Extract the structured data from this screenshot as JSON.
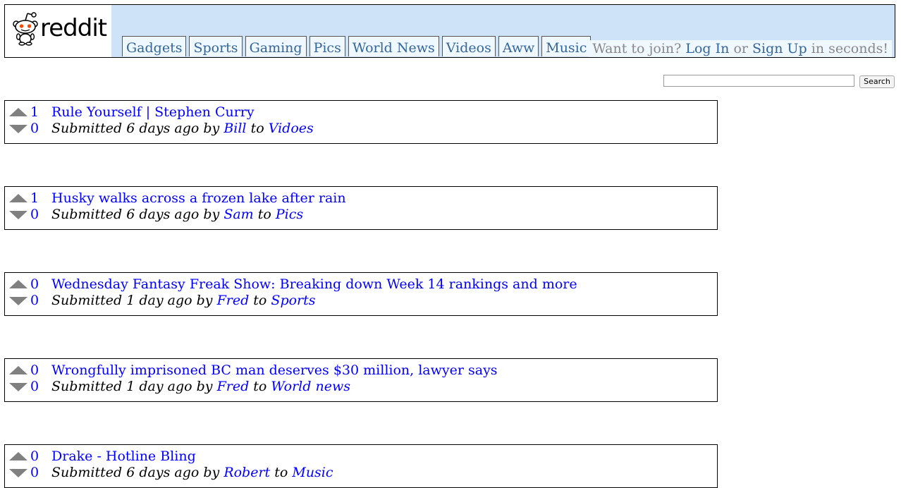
{
  "brand": {
    "name": "reddit"
  },
  "tabs": [
    "Gadgets",
    "Sports",
    "Gaming",
    "Pics",
    "World News",
    "Videos",
    "Aww",
    "Music"
  ],
  "join": {
    "prefix": "Want to join?",
    "login": "Log In",
    "or": "or",
    "signup": "Sign Up",
    "suffix": "in seconds!"
  },
  "search": {
    "placeholder": "",
    "button_label": "Search"
  },
  "meta_words": {
    "submitted": "Submitted",
    "by": "by",
    "to": "to"
  },
  "posts": [
    {
      "up": "1",
      "down": "0",
      "title": "Rule Yourself | Stephen Curry",
      "age": "6 days ago",
      "author": "Bill",
      "sub": "Vidoes"
    },
    {
      "up": "1",
      "down": "0",
      "title": "Husky walks across a frozen lake after rain",
      "age": "6 days ago",
      "author": "Sam",
      "sub": "Pics"
    },
    {
      "up": "0",
      "down": "0",
      "title": "Wednesday Fantasy Freak Show: Breaking down Week 14 rankings and more",
      "age": "1 day ago",
      "author": "Fred",
      "sub": "Sports"
    },
    {
      "up": "0",
      "down": "0",
      "title": "Wrongfully imprisoned BC man deserves $30 million, lawyer says",
      "age": "1 day ago",
      "author": "Fred",
      "sub": "World news"
    },
    {
      "up": "0",
      "down": "0",
      "title": "Drake - Hotline Bling",
      "age": "6 days ago",
      "author": "Robert",
      "sub": "Music"
    }
  ],
  "colors": {
    "header_bg": "#cee3f8",
    "tab_bg": "#eff7ff",
    "tab_text": "#336699",
    "link": "#0000ff",
    "arrow": "#808080",
    "muted": "#888888"
  }
}
